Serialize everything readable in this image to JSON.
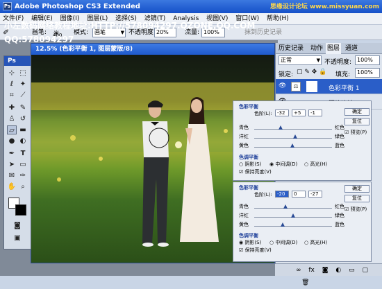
{
  "titlebar": {
    "app_title": "Adobe Photoshop CS3 Extended",
    "ps_badge": "Ps",
    "watermark": "思缘设计论坛 www.missyuan.com"
  },
  "menu": [
    "文件(F)",
    "编辑(E)",
    "图像(I)",
    "图层(L)",
    "选择(S)",
    "滤镜(T)",
    "Analysis",
    "视图(V)",
    "窗口(W)",
    "帮助(H)"
  ],
  "options": {
    "brush_label": "画笔:",
    "brush_size": "400",
    "mode_label": "模式:",
    "mode_value": "画笔",
    "opacity_label": "不透明度:",
    "opacity_value": "20%",
    "flow_label": "流量:",
    "flow_value": "100%",
    "history_label": "抹到历史记录"
  },
  "document": {
    "title": "12.5% (色彩平衡 1, 图层蒙版/8)"
  },
  "overlay": {
    "line1": "小左数码网络教程地址:HTTP://578094297.QZONE.QQ.COM",
    "line2": "QQ:578094297"
  },
  "toolbox": {
    "header": "Ps"
  },
  "layers": {
    "tabs": [
      "历史记录",
      "动作",
      "图层",
      "通道"
    ],
    "blend_mode": "正常",
    "opacity_label": "不透明度:",
    "opacity_value": "100%",
    "lock_label": "锁定:",
    "fill_label": "填充:",
    "fill_value": "100%",
    "layer1_name": "色彩平衡 1",
    "layer2_name": "照片滤镜 1"
  },
  "dialog1": {
    "title": "色彩平衡",
    "level_label": "色阶(L):",
    "levels": [
      "-32",
      "+5",
      "-1"
    ],
    "cyan": "青色",
    "red": "红色",
    "magenta": "洋红",
    "green": "绿色",
    "yellow": "黄色",
    "blue": "蓝色",
    "ok": "确定",
    "reset": "复位",
    "preview": "预览(P)",
    "tone_title": "色调平衡",
    "shadows": "阴影(S)",
    "midtones": "中间调(D)",
    "highlights": "高光(H)",
    "preserve": "保持亮度(V)",
    "selected_tone": "midtones",
    "slider_pos": [
      -32,
      5,
      -1
    ]
  },
  "dialog2": {
    "title": "色彩平衡",
    "level_label": "色阶(L):",
    "levels": [
      "-20",
      "0",
      "-27"
    ],
    "cyan": "青色",
    "red": "红色",
    "magenta": "洋红",
    "green": "绿色",
    "yellow": "黄色",
    "blue": "蓝色",
    "ok": "确定",
    "reset": "复位",
    "preview": "预览(P)",
    "tone_title": "色调平衡",
    "shadows": "阴影(S)",
    "midtones": "中间调(D)",
    "highlights": "高光(H)",
    "preserve": "保持亮度(V)",
    "selected_tone": "shadows",
    "slider_pos": [
      -20,
      0,
      -27
    ]
  }
}
